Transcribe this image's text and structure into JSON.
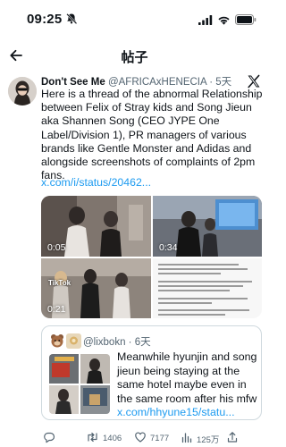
{
  "status_bar": {
    "time": "09:25"
  },
  "header": {
    "title": "帖子"
  },
  "tweet": {
    "display_name": "Don't See Me",
    "handle_time": "@AFRICAxHENECIA · 5天",
    "text": "Here is a thread of the abnormal Relationship between Felix of Stray kids and Song Jieun aka Shannen Song (CEO JYPE One Label/Division 1), PR managers of various brands like Gentle Monster and Adidas and alongside screenshots of complaints of 2pm fans.",
    "link": "x.com/i/status/20462...",
    "media": [
      {
        "duration": "0:05"
      },
      {
        "duration": "0:34"
      },
      {
        "duration": "0:21",
        "watermark": "TikTok"
      },
      {
        "duration": ""
      }
    ]
  },
  "quote": {
    "handle_time": "@lixbokn · 6天",
    "text": "Meanwhile hyunjin and song jieun being staying at the same hotel maybe even in the same room after his mfw ",
    "link": "x.com/hhyune15/statu..."
  },
  "actions": {
    "retweets": "1406",
    "likes": "7177",
    "views": "125万"
  },
  "colors": {
    "link": "#1d9bf0",
    "secondary_text": "#536471",
    "border": "#cfd9de"
  },
  "icons": [
    "bell-slash-icon",
    "signal-icon",
    "wifi-icon",
    "battery-icon",
    "back-arrow-icon",
    "x-logo-icon",
    "reply-icon",
    "retweet-icon",
    "like-icon",
    "views-icon",
    "share-icon"
  ]
}
